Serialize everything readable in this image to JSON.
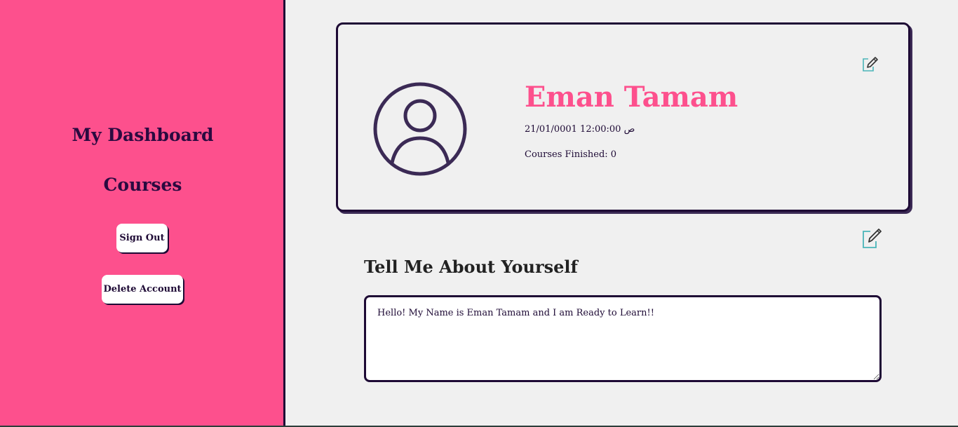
{
  "sidebar": {
    "dashboard_label": "My Dashboard",
    "courses_label": "Courses",
    "sign_out_label": "Sign Out",
    "delete_account_label": "Delete Account"
  },
  "profile": {
    "name": "Eman Tamam",
    "date": "21/01/0001 12:00:00 ص",
    "courses_finished": "Courses Finished: 0",
    "avatar_icon": "user-circle-icon",
    "edit_icon": "edit-icon"
  },
  "about": {
    "title": "Tell Me About Yourself",
    "text": "Hello! My Name is Eman Tamam and I am Ready to Learn!!",
    "edit_icon": "edit-icon"
  },
  "colors": {
    "sidebar_bg": "#fd508d",
    "accent_pink": "#fd508d",
    "dark_purple": "#1e0a35",
    "page_bg": "#f0f0f0",
    "icon_teal": "#4ab5b8"
  }
}
